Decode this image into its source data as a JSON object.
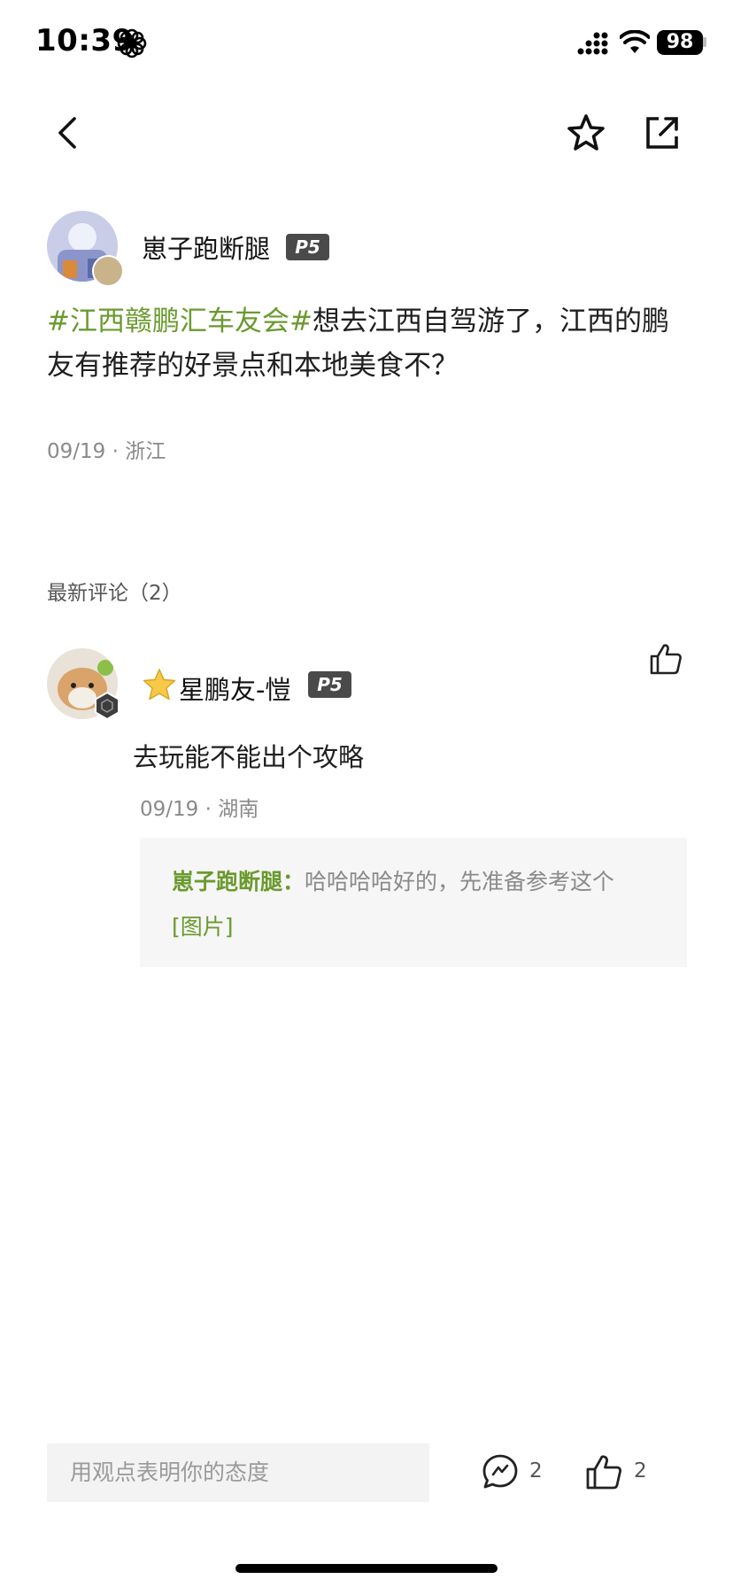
{
  "status_bar": {
    "time": "10:39",
    "battery": "98"
  },
  "post": {
    "author": {
      "name": "崽子跑断腿",
      "level": "P5"
    },
    "hashtag": "#江西赣鹏汇车友会#",
    "text": "想去江西自驾游了，江西的鹏友有推荐的好景点和本地美食不？",
    "date": "09/19",
    "location": "浙江"
  },
  "comments_section": {
    "title": "最新评论（2）",
    "items": [
      {
        "author": {
          "name": "星鹏友-愷",
          "level": "P5"
        },
        "text": "去玩能不能出个攻略",
        "date": "09/19",
        "location": "湖南",
        "reply": {
          "author": "崽子跑断腿：",
          "text": "哈哈哈哈好的，先准备参考这个",
          "link": "[图片]"
        }
      }
    ]
  },
  "bottom_bar": {
    "input_placeholder": "用观点表明你的态度",
    "comment_count": "2",
    "like_count": "2"
  },
  "colors": {
    "accent": "#6a9a2e",
    "badge": "#4a4a4a",
    "reply_bg": "#f6f6f6"
  }
}
